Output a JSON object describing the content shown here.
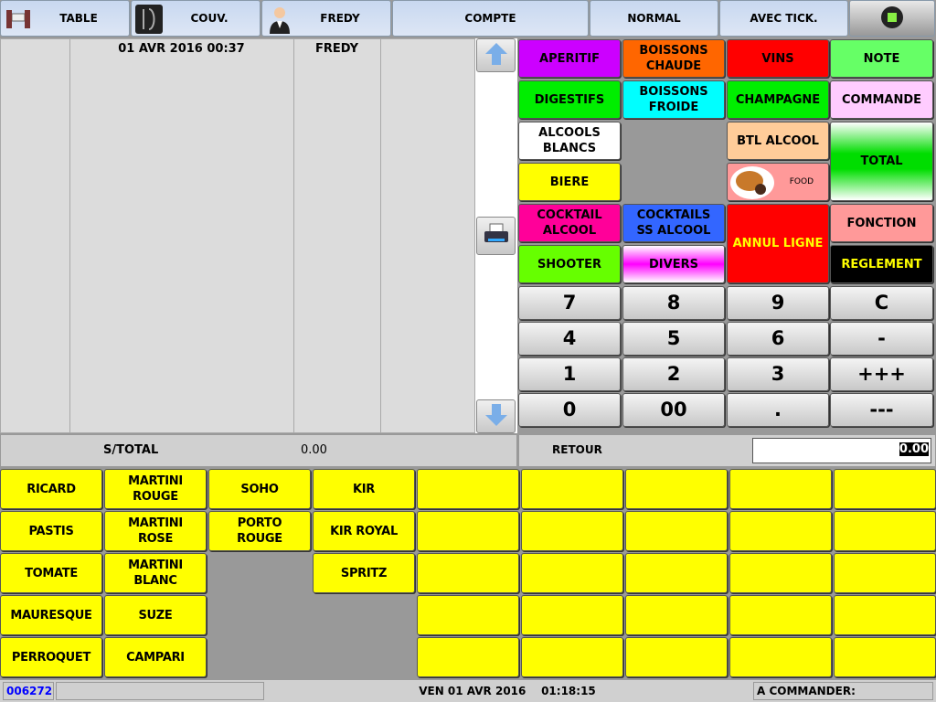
{
  "toolbar": {
    "table": "TABLE",
    "couv": "COUV.",
    "server": "FREDY",
    "compte": "COMPTE",
    "normal": "NORMAL",
    "ticket": "AVEC TICK.",
    "menu_icon": "green-square-icon"
  },
  "ticket": {
    "datetime": "01 AVR 2016 00:37",
    "server": "FREDY"
  },
  "categories": [
    {
      "label": "APERITIF",
      "bg": "#cc00ff",
      "fg": "#000"
    },
    {
      "label": "BOISSONS\nCHAUDE",
      "bg": "#ff6600",
      "fg": "#000"
    },
    {
      "label": "VINS",
      "bg": "#ff0000",
      "fg": "#000"
    },
    {
      "label": "NOTE",
      "bg": "#66ff66",
      "fg": "#000"
    },
    {
      "label": "DIGESTIFS",
      "bg": "#00ee00",
      "fg": "#000"
    },
    {
      "label": "BOISSONS\nFROIDE",
      "bg": "#00ffff",
      "fg": "#000"
    },
    {
      "label": "CHAMPAGNE",
      "bg": "#00ee00",
      "fg": "#000"
    },
    {
      "label": "COMMANDE",
      "bg": "#ffccff",
      "fg": "#000"
    },
    {
      "label": "ALCOOLS\nBLANCS",
      "bg": "#ffffff",
      "fg": "#000"
    },
    {
      "label": "BTL ALCOOL",
      "bg": "#ffcc99",
      "fg": "#000"
    },
    {
      "label": "TOTAL",
      "bg": "linear-gradient(#fff,#00dd00 40%,#00dd00 60%,#fff)",
      "fg": "#000"
    },
    {
      "label": "BIERE",
      "bg": "#ffff00",
      "fg": "#000"
    },
    {
      "label": "FOOD",
      "bg": "#ff9999",
      "fg": "#000"
    },
    {
      "label": "COCKTAIL\nALCOOL",
      "bg": "#ff0099",
      "fg": "#000"
    },
    {
      "label": "COCKTAILS\nSS ALCOOL",
      "bg": "#3366ff",
      "fg": "#000"
    },
    {
      "label": "ANNUL LIGNE",
      "bg": "#ff0000",
      "fg": "#ffff00"
    },
    {
      "label": "FONCTION",
      "bg": "#ff9999",
      "fg": "#000"
    },
    {
      "label": "SHOOTER",
      "bg": "#66ff00",
      "fg": "#000"
    },
    {
      "label": "DIVERS",
      "bg": "linear-gradient(#fff,#ff00ff 50%,#fff)",
      "fg": "#000"
    },
    {
      "label": "REGLEMENT",
      "bg": "#000000",
      "fg": "#ffff00"
    }
  ],
  "numpad": [
    "7",
    "8",
    "9",
    "C",
    "4",
    "5",
    "6",
    "-",
    "1",
    "2",
    "3",
    "+++",
    "0",
    "00",
    ".",
    "---"
  ],
  "subtotal": {
    "label": "S/TOTAL",
    "value": "0.00",
    "retour_label": "RETOUR",
    "retour_value": "0.00"
  },
  "products": [
    [
      "RICARD",
      "MARTINI\nROUGE",
      "SOHO",
      "KIR",
      "",
      "",
      "",
      "",
      ""
    ],
    [
      "PASTIS",
      "MARTINI\nROSE",
      "PORTO\nROUGE",
      "KIR ROYAL",
      "",
      "",
      "",
      "",
      ""
    ],
    [
      "TOMATE",
      "MARTINI\nBLANC",
      null,
      "SPRITZ",
      "",
      "",
      "",
      "",
      ""
    ],
    [
      "MAURESQUE",
      "SUZE",
      null,
      null,
      "",
      "",
      "",
      "",
      ""
    ],
    [
      "PERROQUET",
      "CAMPARI",
      null,
      null,
      "",
      "",
      "",
      "",
      ""
    ]
  ],
  "status": {
    "code": "006272",
    "datetime": "VEN 01 AVR 2016    01:18:15",
    "to_order": "A COMMANDER:"
  }
}
